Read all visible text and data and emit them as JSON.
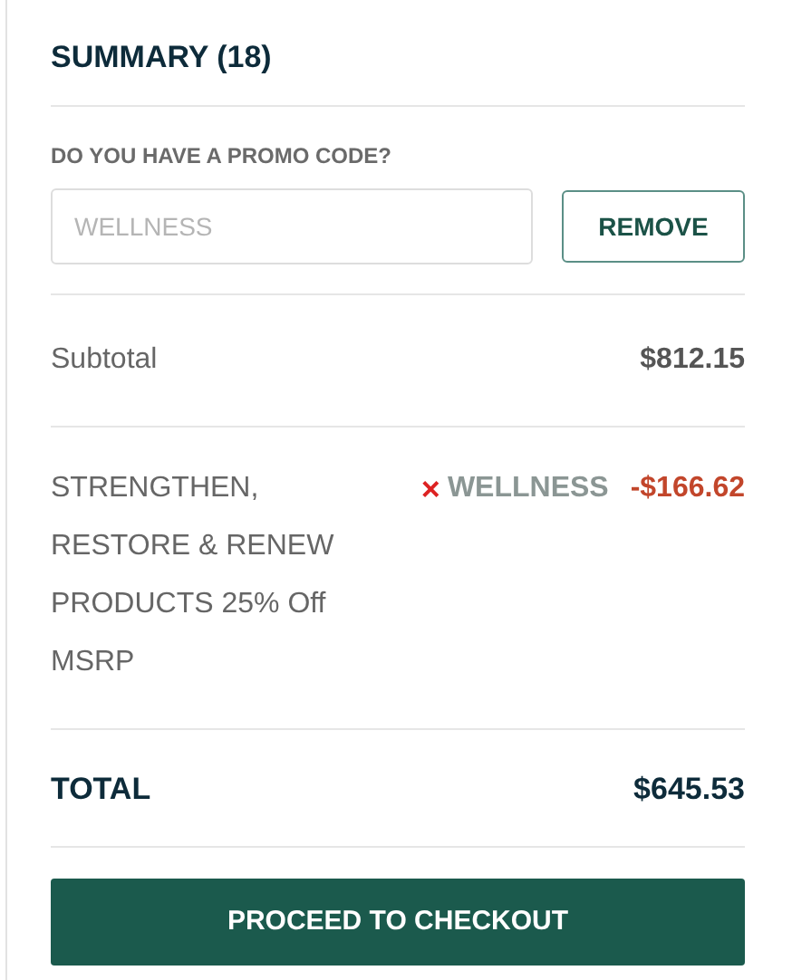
{
  "summary": {
    "title": "SUMMARY (18)"
  },
  "promo": {
    "label": "DO YOU HAVE A PROMO CODE?",
    "placeholder": "WELLNESS",
    "button": "REMOVE"
  },
  "subtotal": {
    "label": "Subtotal",
    "amount": "$812.15"
  },
  "discount": {
    "description": "STRENGTHEN, RESTORE & RENEW PRODUCTS 25% Off MSRP",
    "remove_icon": "×",
    "code": "WELLNESS",
    "amount": "-$166.62"
  },
  "total": {
    "label": "TOTAL",
    "amount": "$645.53"
  },
  "checkout_button": "PROCEED TO CHECKOUT"
}
